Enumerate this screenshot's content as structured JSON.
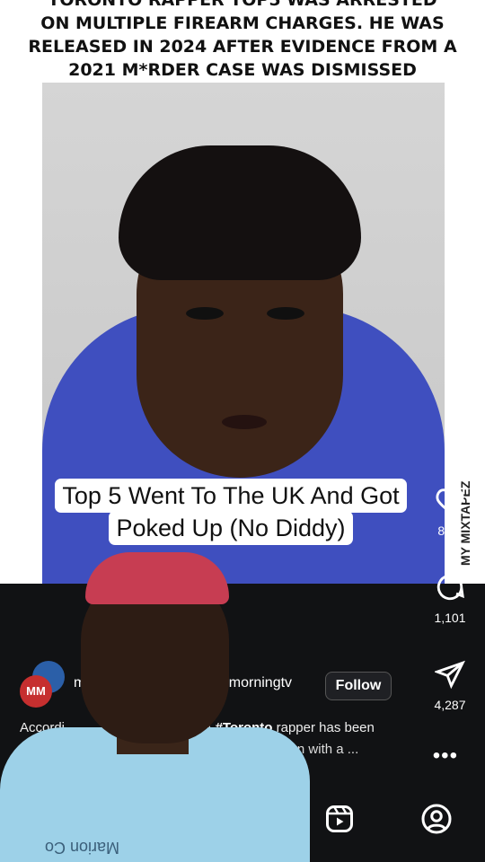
{
  "headline": {
    "lines": [
      "TORONTO RAPPER TOP5 WAS ARRESTED",
      "ON MULTIPLE FIREARM CHARGES. HE WAS",
      "RELEASED IN 2024 AFTER EVIDENCE FROM A",
      "2021 M*RDER CASE WAS DISMISSED"
    ]
  },
  "watermark": "MY MIXTAPEZ",
  "caption": {
    "line1": "Top 5 Went To The UK And Got",
    "line2": "Poked Up (No Diddy)"
  },
  "sidebar": {
    "likes": "8,6..",
    "comments": "1,101",
    "shares": "4,287"
  },
  "account": {
    "avatar_text": "MM",
    "username_start": "my",
    "username_end": "odmorningtv",
    "follow_label": "Follow"
  },
  "description": {
    "line1_start": "Accordi",
    "line1_mid": "A ",
    "hashtag": "#Toronto",
    "line1_end": " rapper has been",
    "line2": "nces in connection with a ..."
  },
  "more_label": "•••",
  "shirt_text": "Marion Co",
  "colors": {
    "background": "#111214",
    "hoodie": "#3f4fbf",
    "accent_red": "#c62f2f"
  },
  "icons": [
    "heart-icon",
    "comment-icon",
    "share-icon",
    "more-icon",
    "reels-icon",
    "profile-icon"
  ]
}
